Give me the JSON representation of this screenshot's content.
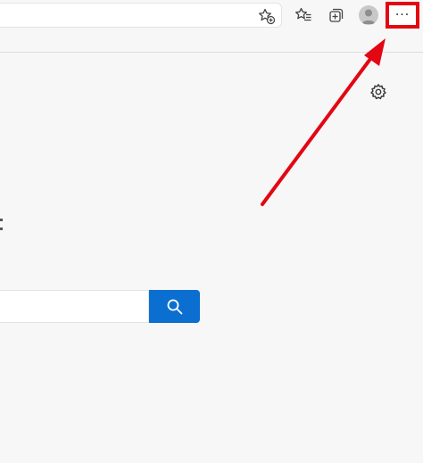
{
  "toolbar": {
    "icons": [
      "add-favorite-icon",
      "favorites-icon",
      "collections-icon",
      "profile-avatar",
      "more-options-icon"
    ],
    "more_symbol": "···"
  },
  "search": {
    "value": "",
    "placeholder": ""
  },
  "colors": {
    "accent_blue": "#0b6fd1",
    "highlight_red": "#e30613",
    "page_background": "#f7f7f7"
  }
}
